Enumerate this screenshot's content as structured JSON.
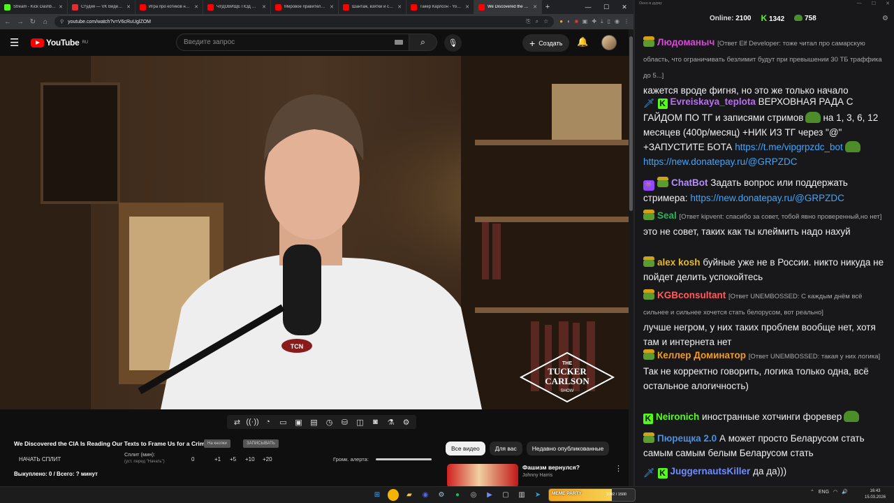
{
  "browser": {
    "tabs": [
      {
        "label": "Stream - Kick Dashboard",
        "color": "#53fc18",
        "active": false
      },
      {
        "label": "Студия — VK Видео Live",
        "color": "#e52d2d",
        "active": false
      },
      {
        "label": "Игра про котиков на Nintendo",
        "color": "#ff0000",
        "active": false
      },
      {
        "label": "ЧУДОВИЩЕ ПОД МАСКОЙ",
        "color": "#ff0000",
        "active": false
      },
      {
        "label": "Мировое правительство",
        "color": "#ff0000",
        "active": false
      },
      {
        "label": "Шантаж, взятки и стрельба",
        "color": "#ff0000",
        "active": false
      },
      {
        "label": "Такер Карлсон - YouTube",
        "color": "#ff0000",
        "active": false
      },
      {
        "label": "We Discovered the CIA",
        "color": "#ff0000",
        "active": true
      }
    ],
    "url": "youtube.com/watch?v=V6cRuUglZOM"
  },
  "youtube": {
    "logo_text": "YouTube",
    "logo_region": "RU",
    "search_placeholder": "Введите запрос",
    "create_label": "Создать",
    "video_title": "We Discovered the CIA Is Reading Our Texts to Frame Us for a Crime",
    "chip_1": "На кнопки",
    "chip_2": "ЗАПИСЫВАТЬ",
    "split_start": "НАЧАТЬ СПЛИТ",
    "split_minutes_label": "Сплит (мин):",
    "split_minutes_hint": "(уст. перед \"Начать\")",
    "split_value": "0",
    "split_increments": [
      "+1",
      "+5",
      "+10",
      "+20"
    ],
    "alert_volume_label": "Громк. алерта:",
    "bought_text": "Выкуплено: 0 / Всего: ? минут",
    "filters": [
      "Все видео",
      "Для вас",
      "Недавно опубликованные"
    ],
    "recommendation": {
      "title": "Фашизм вернулся?",
      "channel": "Johnny Harris"
    },
    "watermark": {
      "line1": "THE",
      "line2": "TUCKER",
      "line3": "CARLSON",
      "line4": "SHOW"
    },
    "mic_label": "TCN"
  },
  "chat": {
    "window_title": "Окно в дурку",
    "online_label": "Online:",
    "online_count": "2100",
    "kick_count": "1342",
    "pepe_count": "758",
    "messages": [
      {
        "user": "Людоманыч",
        "color": "#d64bd6",
        "reply": "[Ответ Elf Developer: тоже читал про самарскую область, что ограничивать безлимит будут при превышении 30 ТБ траффика до 5...]",
        "text": "кажется вроде фигня, но это же только начало"
      },
      {
        "user": "Evreiskaya_teplota",
        "color": "#ba6cf5",
        "text_1": "ВЕРХОВНАЯ РАДА С ГАЙДОМ ПО ТГ и записями стримов",
        "text_2": "на 1, 3, 6, 12 месяцев (400р/месяц) +НИК ИЗ ТГ через \"@\" +ЗАПУСТИТЕ БОТА",
        "link_1": "https://t.me/vipgrpzdc_bot",
        "link_2": "https://new.donatepay.ru/@GRPZDC"
      },
      {
        "user": "ChatBot",
        "color": "#b88cff",
        "text": "Задать вопрос или поддержать стримера:",
        "link": "https://new.donatepay.ru/@GRPZDC"
      },
      {
        "user": "Seal",
        "color": "#2fb05b",
        "reply": "[Ответ kipvent: спасибо за совет, тобой явно проверенный,но нет]",
        "text": "это не совет, таких как ты клеймить надо нахуй"
      },
      {
        "user": "alex kosh",
        "color": "#e8b923",
        "text": "буйные уже не в России. никто никуда не пойдет делить успокойтесь"
      },
      {
        "user": "KGBconsultant",
        "color": "#ff5d5d",
        "reply": "[Ответ UNEMBOSSED: С каждым днём всё сильнее и сильнее хочется стать белорусом, вот реально]",
        "text": "лучше негром, у них таких проблем вообще нет, хотя там и интернета нет"
      },
      {
        "user": "Келлер Доминатор",
        "color": "#f39c1f",
        "reply": "[Ответ UNEMBOSSED: такая у них логика]",
        "text": "Так не корректно говорить, логика только одна, всё остальное алогичность)"
      },
      {
        "user": "Neironich",
        "color": "#53fc18",
        "text": "иностранные хотчинги форевер"
      },
      {
        "user": "Пюрещка 2.0",
        "color": "#4a90e2",
        "text": "А может просто Беларусом стать самым самым белым Беларусом стать"
      },
      {
        "user": "JuggernautsKiller",
        "color": "#6f8cff",
        "text": "да да)))"
      }
    ]
  },
  "taskbar": {
    "meme_label": "МЕМЕ PARTY",
    "meme_count": "1092 / 1500",
    "meme_progress": 0.73,
    "lang": "ENG",
    "time": "16:43",
    "date": "15.03.2026"
  }
}
